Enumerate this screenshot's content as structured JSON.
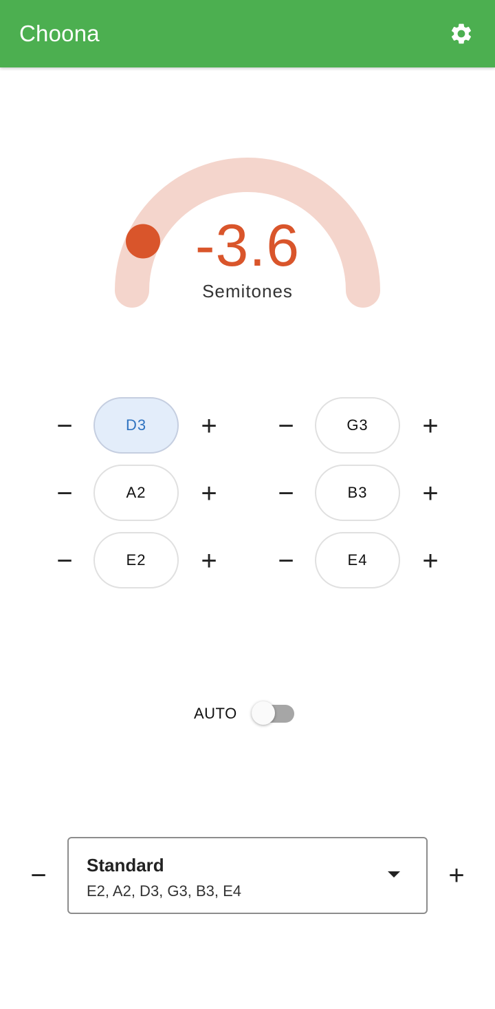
{
  "app": {
    "title": "Choona",
    "settings_icon": "gear-icon",
    "accent_color": "#4caf50"
  },
  "gauge": {
    "value": "-3.6",
    "unit": "Semitones",
    "min": -5,
    "max": 5,
    "current": -3.6,
    "track_color": "#f4d5cc",
    "indicator_color": "#d9552b"
  },
  "strings": [
    {
      "note": "D3",
      "selected": true,
      "decrease_icon": "minus-icon",
      "increase_icon": "plus-icon"
    },
    {
      "note": "G3",
      "selected": false,
      "decrease_icon": "minus-icon",
      "increase_icon": "plus-icon"
    },
    {
      "note": "A2",
      "selected": false,
      "decrease_icon": "minus-icon",
      "increase_icon": "plus-icon"
    },
    {
      "note": "B3",
      "selected": false,
      "decrease_icon": "minus-icon",
      "increase_icon": "plus-icon"
    },
    {
      "note": "E2",
      "selected": false,
      "decrease_icon": "minus-icon",
      "increase_icon": "plus-icon"
    },
    {
      "note": "E4",
      "selected": false,
      "decrease_icon": "minus-icon",
      "increase_icon": "plus-icon"
    }
  ],
  "auto": {
    "label": "AUTO",
    "enabled": false
  },
  "tuning": {
    "name": "Standard",
    "notes": "E2, A2, D3, G3, B3, E4",
    "dropdown_icon": "dropdown-arrow-icon",
    "decrease_icon": "minus-icon",
    "increase_icon": "plus-icon"
  },
  "glyphs": {
    "minus": "−",
    "plus": "+"
  }
}
